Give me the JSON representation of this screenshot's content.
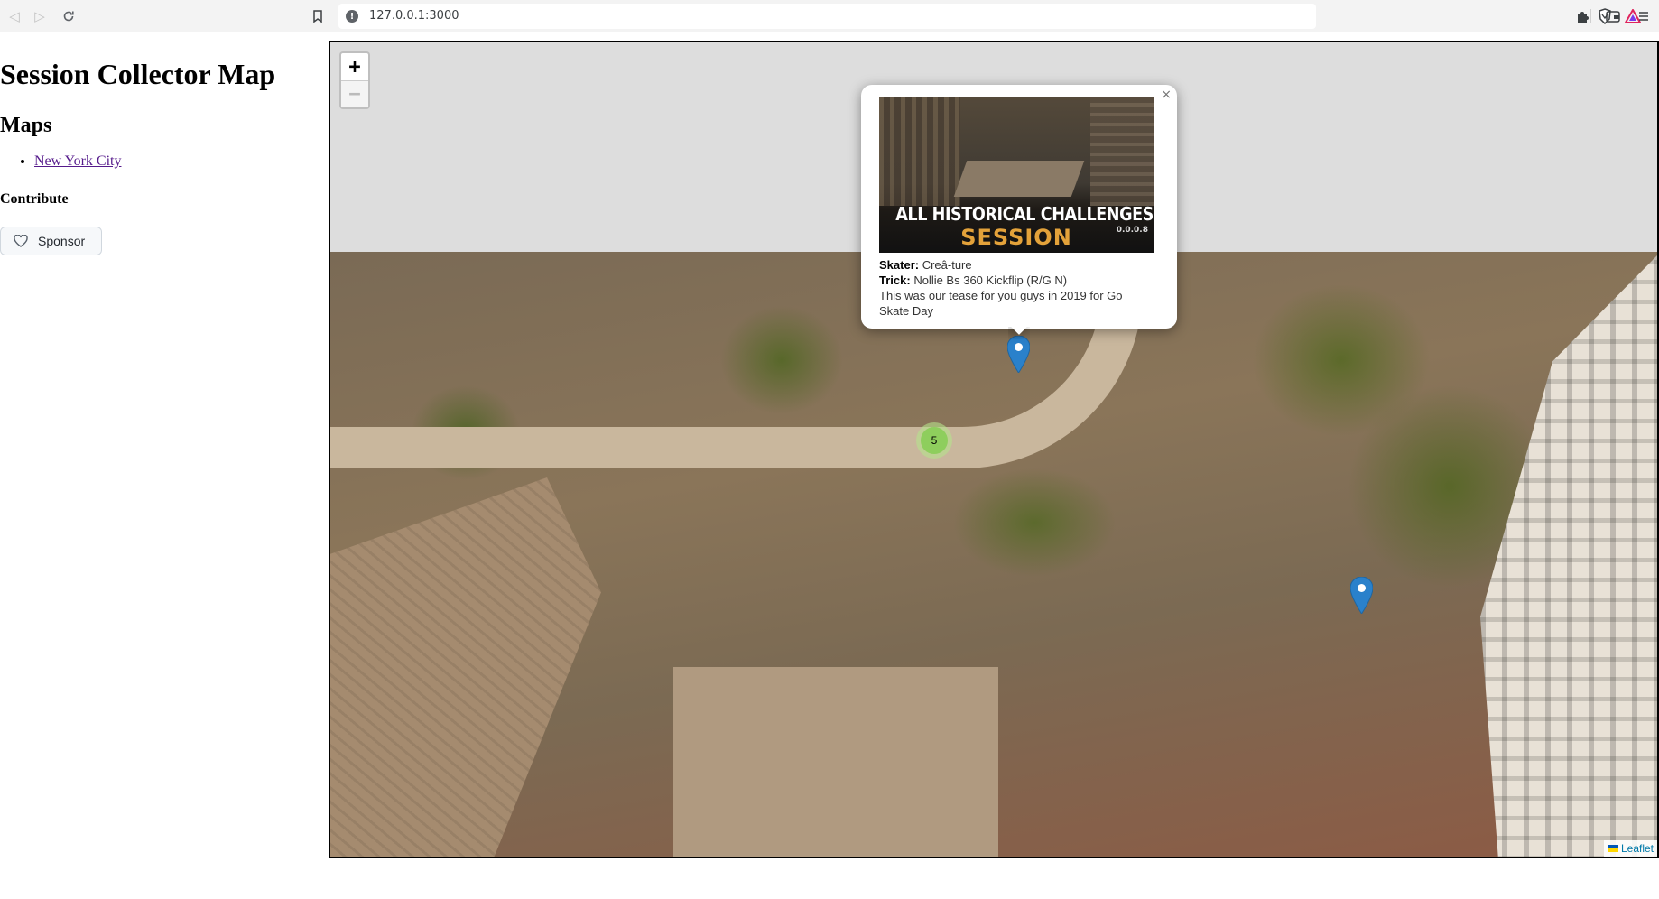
{
  "browser": {
    "url": "127.0.0.1:3000",
    "back_icon": "back-arrow-icon",
    "forward_icon": "forward-arrow-icon",
    "reload_icon": "reload-icon",
    "bookmark_icon": "bookmark-icon",
    "info_icon": "info-icon",
    "extensions": [
      "brave-shield-icon",
      "brave-rewards-icon",
      "extensions-puzzle-icon",
      "wallet-icon",
      "menu-icon"
    ]
  },
  "page": {
    "title": "Session Collector Map",
    "maps_heading": "Maps",
    "maps": [
      {
        "label": "New York City"
      }
    ],
    "contribute_heading": "Contribute",
    "sponsor_label": "Sponsor"
  },
  "map": {
    "zoom_in": "+",
    "zoom_out": "−",
    "cluster_count": "5",
    "attribution": "Leaflet",
    "popup": {
      "thumbnail_title": "ALL HISTORICAL CHALLENGES",
      "thumbnail_logo": "SESSION",
      "thumbnail_version": "0.0.0.8",
      "skater_label": "Skater:",
      "skater": "Creâ-ture",
      "trick_label": "Trick:",
      "trick": "Nollie Bs 360 Kickflip (R/G N)",
      "description": "This was our tease for you guys in 2019 for Go Skate Day",
      "close": "×"
    },
    "colors": {
      "marker": "#2a81cb",
      "cluster_outer": "#b5e28c",
      "cluster_inner": "#6ecc39",
      "attribution_link": "#0078a8"
    }
  }
}
